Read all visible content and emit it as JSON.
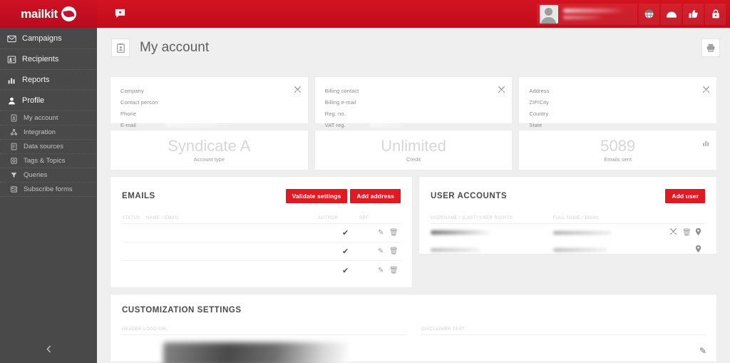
{
  "brand": {
    "name": "mailkit",
    "logo_icon": "mailkit-leaf-icon"
  },
  "topbar": {
    "chat_icon": "chat-bubble-icon",
    "user_name_redacted": "",
    "actions": [
      {
        "icon": "globe-icon",
        "name": "language-button"
      },
      {
        "icon": "envelope-icon",
        "name": "messages-button"
      },
      {
        "icon": "thumbs-up-icon",
        "name": "feedback-button"
      },
      {
        "icon": "lock-icon",
        "name": "logout-button"
      }
    ]
  },
  "sidebar": {
    "items": [
      {
        "label": "Campaigns",
        "icon": "envelope-icon",
        "level": "top"
      },
      {
        "label": "Recipients",
        "icon": "contact-card-icon",
        "level": "top"
      },
      {
        "label": "Reports",
        "icon": "bar-chart-icon",
        "level": "top"
      },
      {
        "label": "Profile",
        "icon": "user-icon",
        "level": "section"
      },
      {
        "label": "My account",
        "icon": "id-badge-icon",
        "level": "sub",
        "active": true
      },
      {
        "label": "Integration",
        "icon": "share-nodes-icon",
        "level": "sub"
      },
      {
        "label": "Data sources",
        "icon": "database-icon",
        "level": "sub"
      },
      {
        "label": "Tags & Topics",
        "icon": "tag-icon",
        "level": "sub"
      },
      {
        "label": "Queries",
        "icon": "funnel-icon",
        "level": "sub"
      },
      {
        "label": "Subscribe forms",
        "icon": "form-icon",
        "level": "sub"
      }
    ],
    "collapse_icon": "chevron-left-icon"
  },
  "page": {
    "title": "My account",
    "title_icon": "clipboard-user-icon",
    "print_icon": "printer-icon"
  },
  "company_card": {
    "edit_icon": "tools-icon",
    "fields": [
      {
        "label": "Company",
        "value_redacted": true,
        "value_width": 52
      },
      {
        "label": "Contact person",
        "value_redacted": true,
        "value_width": 58
      },
      {
        "label": "Phone",
        "value_redacted": false,
        "value_width": 0
      },
      {
        "label": "E-mail",
        "value_redacted": true,
        "value_width": 96
      }
    ]
  },
  "billing_card": {
    "edit_icon": "tools-icon",
    "fields": [
      {
        "label": "Billing contact",
        "value_redacted": true,
        "value_width": 50
      },
      {
        "label": "Billing e-mail",
        "value_redacted": true,
        "value_width": 92
      },
      {
        "label": "Reg. no.",
        "value_redacted": true,
        "value_width": 42
      },
      {
        "label": "VAT reg.",
        "value_redacted": true,
        "value_width": 58
      }
    ]
  },
  "address_card": {
    "edit_icon": "tools-icon",
    "fields": [
      {
        "label": "Address",
        "value_redacted": true,
        "value_width": 52
      },
      {
        "label": "ZIP/City",
        "value_redacted": true,
        "value_width": 78
      },
      {
        "label": "Country",
        "value_redacted": true,
        "value_width": 66
      },
      {
        "label": "State",
        "value_redacted": false,
        "value_width": 0
      }
    ]
  },
  "stats": [
    {
      "value": "Syndicate A",
      "label": "Account type",
      "icon": null
    },
    {
      "value": "Unlimited",
      "label": "Credit",
      "icon": null
    },
    {
      "value": "5089",
      "label": "Emails sent",
      "icon": "bar-chart-icon"
    }
  ],
  "emails_panel": {
    "title": "EMAILS",
    "validate_label": "Validate settings",
    "add_label": "Add address",
    "columns": [
      "STATUS",
      "NAME / EMAIL",
      "AUTHOR",
      "SPF"
    ],
    "rows": [
      {
        "name_redacted": true,
        "status_pill": true,
        "spf_ok": "✔",
        "edit_icon": "pencil-icon",
        "delete_icon": "trash-icon"
      },
      {
        "name_redacted": true,
        "status_pill": true,
        "spf_ok": "✔",
        "edit_icon": "pencil-icon",
        "delete_icon": "trash-icon"
      },
      {
        "name_redacted": true,
        "status_pill": true,
        "spf_ok": "✔",
        "edit_icon": "pencil-icon",
        "delete_icon": "trash-icon"
      }
    ]
  },
  "users_panel": {
    "title": "USER ACCOUNTS",
    "add_label": "Add user",
    "columns": [
      "USERNAME / (LAST) USER RIGHTS",
      "FULL NAME / EMAIL"
    ],
    "rows": [
      {
        "user_redacted": true,
        "name_redacted": true,
        "actions": [
          "tools-icon",
          "trash-icon",
          "map-pin-icon"
        ]
      },
      {
        "user_redacted": true,
        "name_redacted": true,
        "actions": [
          "map-pin-icon"
        ]
      }
    ]
  },
  "customization_panel": {
    "title": "CUSTOMIZATION SETTINGS",
    "header_logo_label": "HEADER LOGO URL",
    "disclaimer_label": "DISCLAIMER TEXT",
    "edit_icon": "pencil-icon"
  },
  "colors": {
    "brand_red": "#c8102e",
    "topbar_red": "#d0111f",
    "sidebar_dark": "#494949",
    "page_bg": "#efefef",
    "button_red": "#e01a22"
  }
}
